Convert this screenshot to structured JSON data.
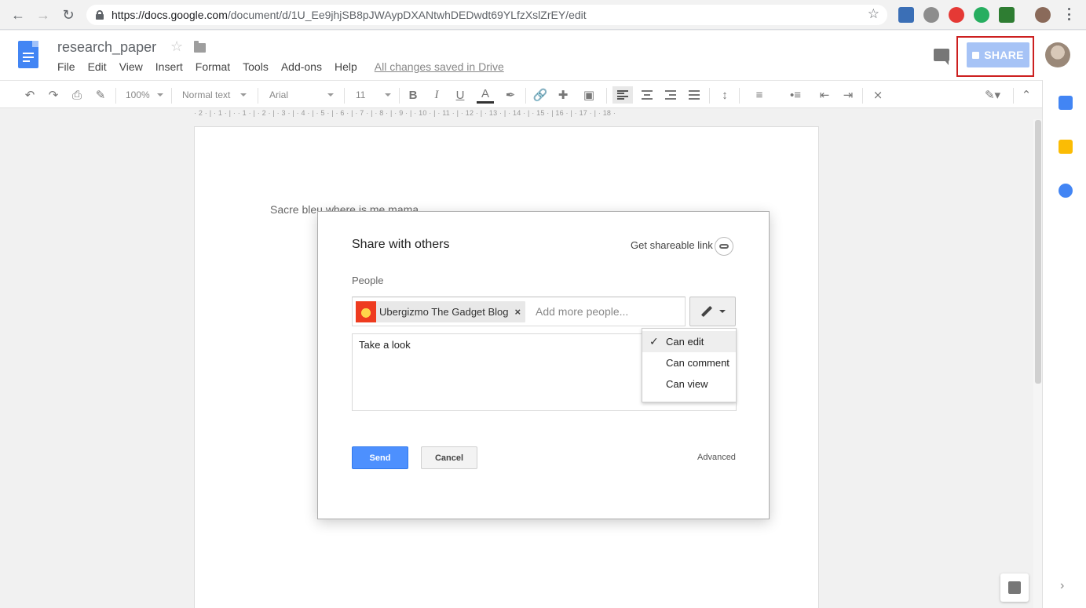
{
  "browser": {
    "url_host": "https://docs.google.com",
    "url_path": "/document/d/1U_Ee9jhjSB8pJWAypDXANtwhDEDwdt69YLfzXslZrEY/edit"
  },
  "doc": {
    "title": "research_paper",
    "menu": [
      "File",
      "Edit",
      "View",
      "Insert",
      "Format",
      "Tools",
      "Add-ons",
      "Help"
    ],
    "saved_status": "All changes saved in Drive",
    "share_label": "SHARE",
    "body_text": "Sacre bleu where is me mama"
  },
  "toolbar": {
    "zoom": "100%",
    "style": "Normal text",
    "font": "Arial",
    "size": "11",
    "bold": "B",
    "italic": "I",
    "underline": "U",
    "text_color": "A"
  },
  "ruler": {
    "text": "· 2 · | · 1 · | ·     · 1 · | · 2 · | · 3 · | · 4 · | · 5 · | · 6 · | · 7 · | · 8 · | · 9 · | · 10 · | · 11 · | · 12 · | · 13 · | · 14 · | · 15 · | 16 · | · 17 · | · 18 ·"
  },
  "dialog": {
    "title": "Share with others",
    "shareable_link": "Get shareable link",
    "people_label": "People",
    "recipient": "Ubergizmo The Gadget Blog",
    "remove": "×",
    "add_placeholder": "Add more people...",
    "message": "Take a look",
    "permissions": [
      {
        "label": "Can edit",
        "selected": true
      },
      {
        "label": "Can comment",
        "selected": false
      },
      {
        "label": "Can view",
        "selected": false
      }
    ],
    "check": "✓",
    "send": "Send",
    "cancel": "Cancel",
    "advanced": "Advanced"
  },
  "colors": {
    "accent_blue": "#4d90fe",
    "share_disabled": "#a6c3f6",
    "highlight_red": "#cc1f1f"
  }
}
